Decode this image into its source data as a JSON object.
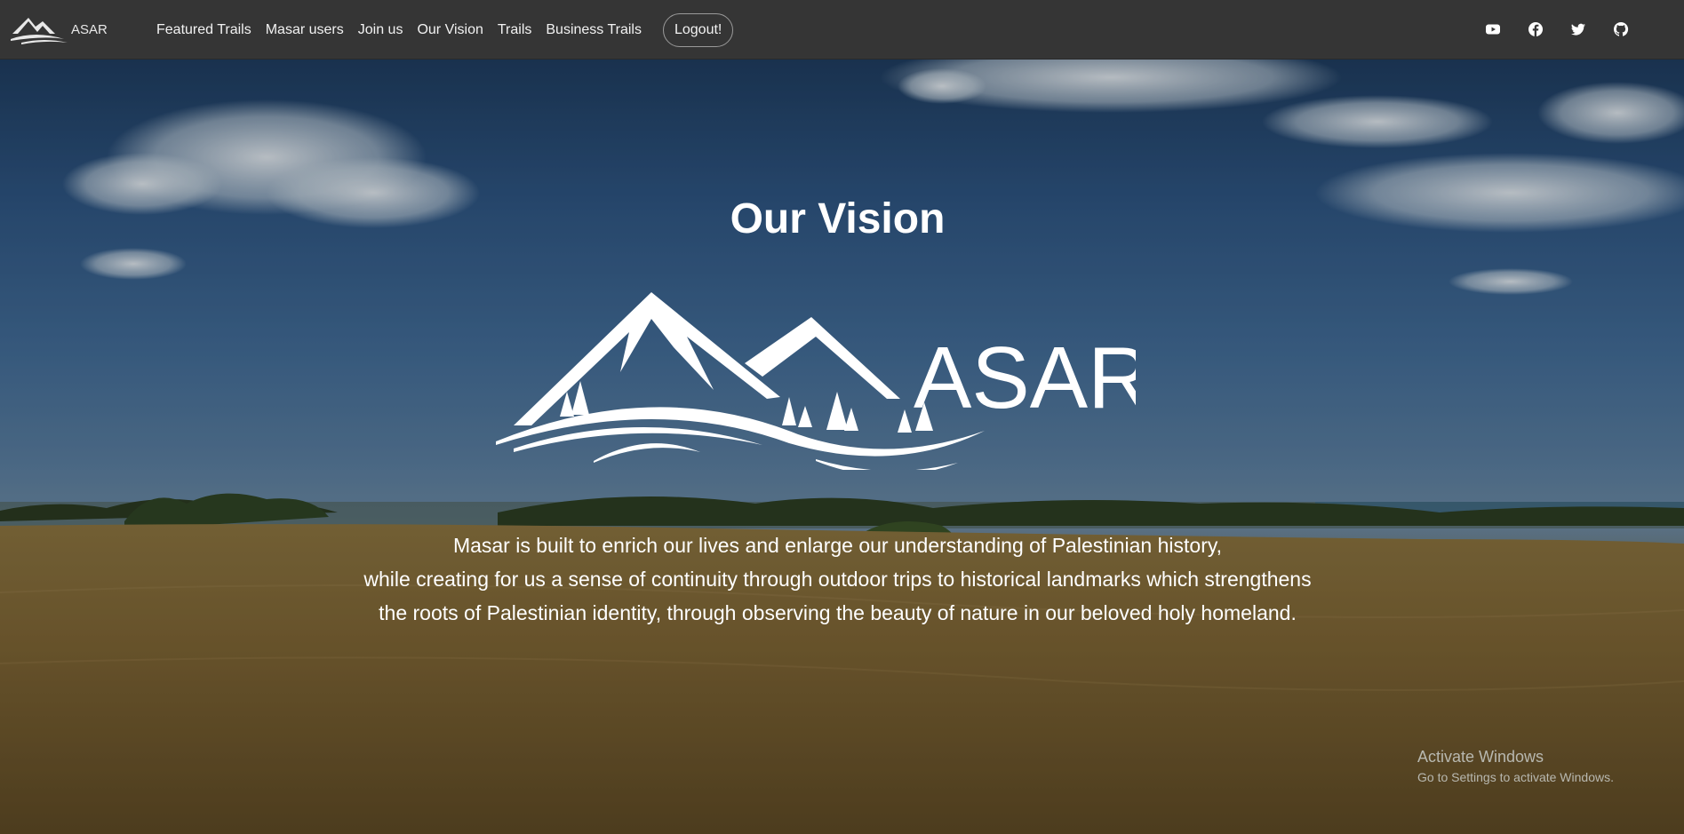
{
  "brand": {
    "logo_text": "ASAR"
  },
  "nav": {
    "links": [
      "Featured Trails",
      "Masar users",
      "Join us",
      "Our Vision",
      "Trails",
      "Business Trails"
    ],
    "logout_label": "Logout!"
  },
  "social": [
    "youtube-icon",
    "facebook-icon",
    "twitter-icon",
    "github-icon"
  ],
  "hero": {
    "title": "Our Vision",
    "logo_text": "ASAR",
    "text_lines": [
      "Masar is built to enrich our lives and enlarge our understanding of Palestinian history,",
      "while creating for us a sense of continuity through outdoor trips to historical landmarks which strengthens",
      "the roots of Palestinian identity, through observing the beauty of nature in our beloved holy homeland."
    ]
  },
  "watermark": {
    "title": "Activate Windows",
    "subtitle": "Go to Settings to activate Windows."
  },
  "colors": {
    "navbar": "#353535",
    "text": "#ffffff",
    "sky": "#2e5582",
    "field": "#7a6432"
  }
}
